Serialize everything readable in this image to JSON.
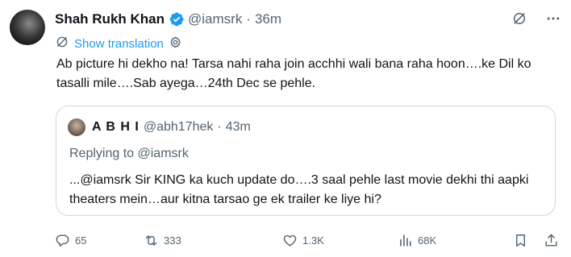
{
  "author": {
    "name": "Shah Rukh Khan",
    "handle": "@iamsrk",
    "separator": "·",
    "time": "36m",
    "verified_color": "#1d9bf0"
  },
  "translate": {
    "label": "Show translation",
    "icon": "translate-icon"
  },
  "tweet": {
    "text": "Ab picture hi dekho na! Tarsa nahi raha join acchhi wali bana raha hoon….ke Dil ko tasalli mile….Sab ayega…24th Dec se pehle."
  },
  "quote": {
    "name": "A B H I",
    "handle": "@abh17hek",
    "separator": "·",
    "time": "43m",
    "replying_prefix": "Replying to ",
    "replying_handle": "@iamsrk",
    "text": "...@iamsrk Sir KING ka kuch update do….3 saal pehle last movie dekhi thi aapki theaters mein…aur kitna tarsao ge ek trailer ke liye hi?"
  },
  "actions": {
    "replies": "65",
    "reposts": "333",
    "likes": "1.3K",
    "views": "68K"
  },
  "colors": {
    "text": "#0f1419",
    "secondary": "#536471",
    "accent": "#1d9bf0",
    "border": "#cfd9de"
  }
}
